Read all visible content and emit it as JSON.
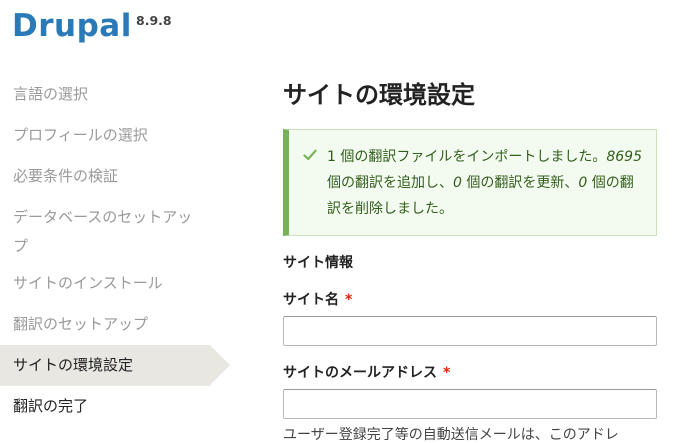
{
  "header": {
    "logo_text": "Drupal",
    "version": "8.9.8"
  },
  "sidebar": {
    "tasks": [
      {
        "label": "言語の選択",
        "state": "done"
      },
      {
        "label": "プロフィールの選択",
        "state": "done"
      },
      {
        "label": "必要条件の検証",
        "state": "done"
      },
      {
        "label": "データベースのセットアップ",
        "state": "done"
      },
      {
        "label": "サイトのインストール",
        "state": "done"
      },
      {
        "label": "翻訳のセットアップ",
        "state": "done"
      },
      {
        "label": "サイトの環境設定",
        "state": "active"
      },
      {
        "label": "翻訳の完了",
        "state": "todo"
      }
    ]
  },
  "main": {
    "title": "サイトの環境設定",
    "message": {
      "part1": "1 個の翻訳ファイルをインポートしました。",
      "added_count": "8695",
      "part2": " 個の翻訳を追加し、",
      "updated_count": "0",
      "part3": " 個の翻訳を更新、",
      "deleted_count": "0",
      "part4": " 個の翻訳を削除しました。",
      "status_color": "#77b259"
    },
    "site_info": {
      "section_title": "サイト情報",
      "site_name_label": "サイト名",
      "site_name_value": "",
      "site_mail_label": "サイトのメールアドレス",
      "site_mail_value": "",
      "site_mail_description": "ユーザー登録完了等の自動送信メールは、このアドレ",
      "required_marker": "*"
    }
  }
}
